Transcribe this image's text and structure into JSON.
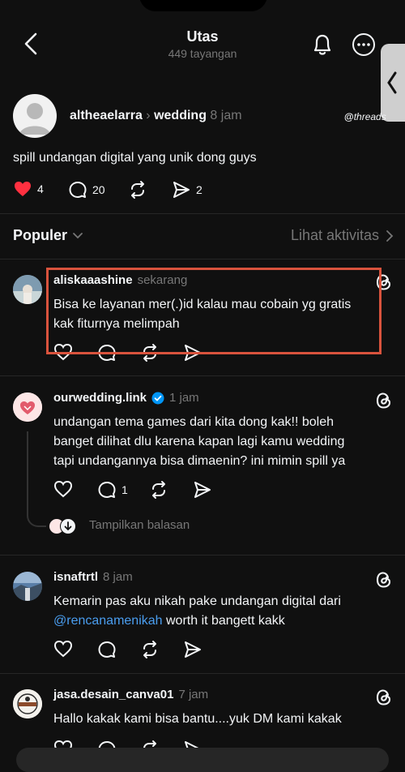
{
  "header": {
    "title": "Utas",
    "subtitle": "449 tayangan"
  },
  "post": {
    "username": "altheaelarra",
    "community": "wedding",
    "time": "8 jam",
    "badge": "threads",
    "text": "spill undangan digital yang unik dong guys",
    "likes": "4",
    "comments": "20",
    "shares": "2"
  },
  "sort": {
    "label": "Populer",
    "activity_link": "Lihat aktivitas"
  },
  "replies": [
    {
      "username": "aliskaaashine",
      "time": "sekarang",
      "line1": "Bisa ke layanan mer(.)id kalau mau cobain yg gratis",
      "line2": "kak fiturnya melimpah"
    },
    {
      "username": "ourwedding.link",
      "verified": true,
      "time": "1 jam",
      "line1": "undangan tema games dari kita dong kak!! boleh",
      "line2": "banget dilihat dlu karena kapan lagi kamu wedding",
      "line3": "tapi undangannya bisa dimaenin? ini mimin spill ya",
      "comments": "1",
      "show_replies": "Tampilkan balasan"
    },
    {
      "username": "isnaftrtl",
      "time": "8 jam",
      "line1": "Kemarin pas aku nikah pake undangan digital dari",
      "mention": "@rencanamenikah",
      "line2_rest": " worth it bangett kakk"
    },
    {
      "username": "jasa.desain_canva01",
      "time": "7 jam",
      "line1": "Hallo kakak kami bisa bantu....yuk DM kami kakak"
    }
  ],
  "colors": {
    "background": "#101010",
    "text": "#f3f5f7",
    "muted": "#777777",
    "like": "#ff3040",
    "link": "#4a9ef0",
    "verified": "#0095f6",
    "highlight": "#d9533d"
  }
}
